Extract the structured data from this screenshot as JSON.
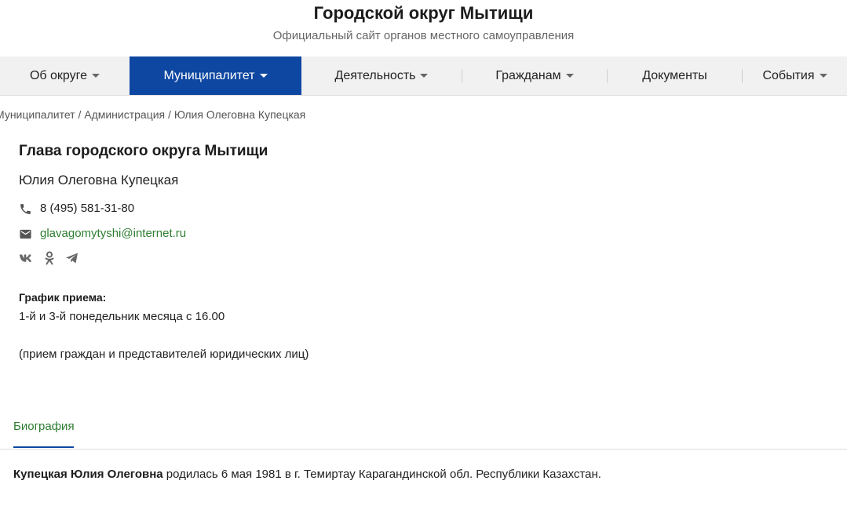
{
  "header": {
    "title": "Городской округ Мытищи",
    "subtitle": "Официальный сайт органов местного самоуправления"
  },
  "nav": {
    "items": [
      {
        "label": "Об округе",
        "has_dropdown": true,
        "active": false
      },
      {
        "label": "Муниципалитет",
        "has_dropdown": true,
        "active": true
      },
      {
        "label": "Деятельность",
        "has_dropdown": true,
        "active": false
      },
      {
        "label": "Гражданам",
        "has_dropdown": true,
        "active": false
      },
      {
        "label": "Документы",
        "has_dropdown": false,
        "active": false
      },
      {
        "label": "События",
        "has_dropdown": true,
        "active": false
      }
    ],
    "active_color": "#0d47a1"
  },
  "breadcrumb": {
    "items": [
      "Муниципалитет",
      "Администрация",
      "Юлия Олеговна Купецкая"
    ],
    "separator": " / "
  },
  "person": {
    "role": "Глава городского округа Мытищи",
    "name": "Юлия Олеговна Купецкая",
    "phone": "8 (495) 581-31-80",
    "email": "glavagomytyshi@internet.ru",
    "socials": [
      "vk-icon",
      "odnoklassniki-icon",
      "telegram-icon"
    ]
  },
  "schedule": {
    "label": "График приема:",
    "time": "1-й и 3-й понедельник месяца с 16.00",
    "note": "(прием граждан и представителей юридических лиц)"
  },
  "tabs": {
    "biography_label": "Биография"
  },
  "biography": {
    "name_bold": "Купецкая Юлия Олеговна",
    "text": " родилась 6 мая 1981 в г. Темиртау Карагандинской обл. Республики Казахстан."
  },
  "colors": {
    "link_green": "#2e7d32",
    "nav_background": "#f1f1f1"
  }
}
